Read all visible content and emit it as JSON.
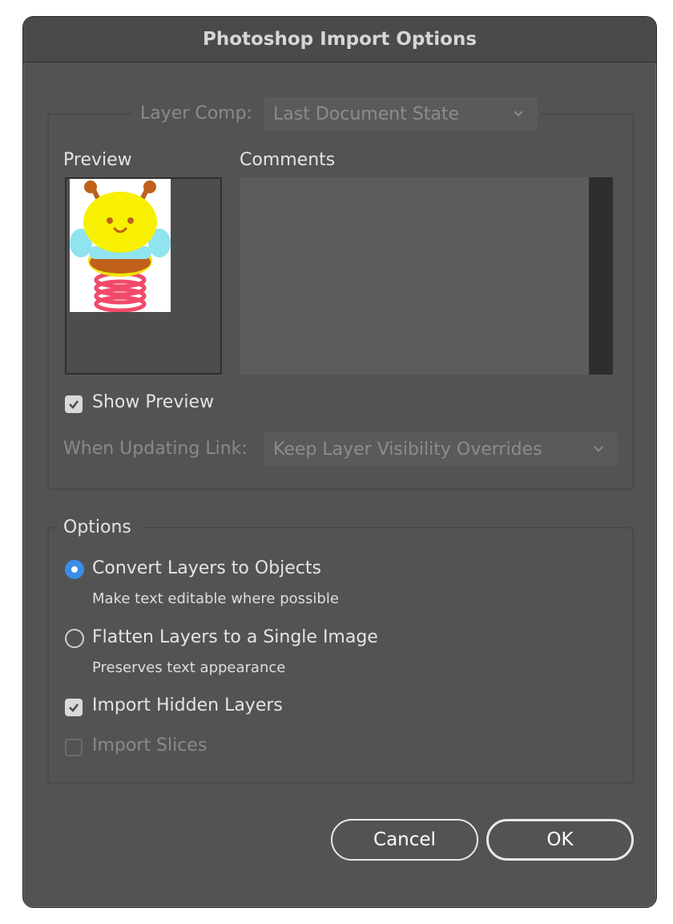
{
  "dialog": {
    "title": "Photoshop Import Options"
  },
  "layer_comp": {
    "label": "Layer Comp:",
    "value": "Last Document State",
    "icon": "chevron-down-icon"
  },
  "preview": {
    "label": "Preview"
  },
  "comments": {
    "label": "Comments"
  },
  "show_preview": {
    "label": "Show Preview",
    "checked": true
  },
  "when_updating": {
    "label": "When Updating Link:",
    "value": "Keep Layer Visibility Overrides",
    "icon": "chevron-down-icon"
  },
  "options": {
    "legend": "Options",
    "convert": {
      "label": "Convert Layers to Objects",
      "note": "Make text editable where possible",
      "selected": true
    },
    "flatten": {
      "label": "Flatten Layers to a Single Image",
      "note": "Preserves text appearance",
      "selected": false
    },
    "import_hidden": {
      "label": "Import Hidden Layers",
      "checked": true
    },
    "import_slices": {
      "label": "Import Slices",
      "checked": false
    }
  },
  "buttons": {
    "cancel": "Cancel",
    "ok": "OK"
  },
  "colors": {
    "dialog_bg": "#535353",
    "radio_accent": "#3a8ee6"
  }
}
